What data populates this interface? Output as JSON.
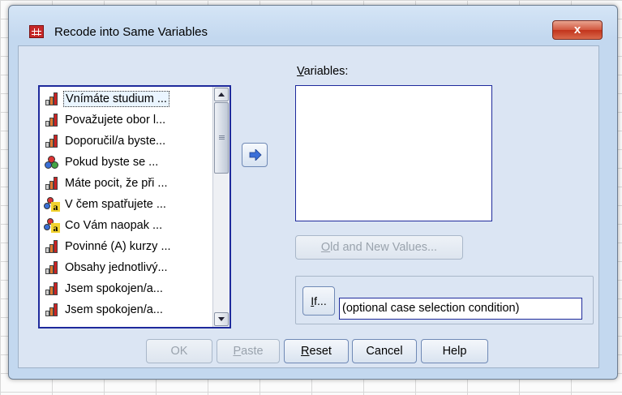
{
  "window": {
    "title": "Recode into Same Variables",
    "close_label": "x",
    "app_icon": "spss-data-grid-icon"
  },
  "source_list": {
    "items": [
      {
        "label": "Vnímáte studium ...",
        "icon": "ordinal-bar-icon",
        "selected": true
      },
      {
        "label": "Považujete obor l...",
        "icon": "ordinal-bar-icon"
      },
      {
        "label": "Doporučil/a byste...",
        "icon": "ordinal-bar-icon"
      },
      {
        "label": "Pokud byste se ...",
        "icon": "nominal-circles-icon"
      },
      {
        "label": "Máte pocit, že při ...",
        "icon": "ordinal-bar-icon"
      },
      {
        "label": "V čem spatřujete ...",
        "icon": "string-nominal-icon"
      },
      {
        "label": "Co Vám naopak ...",
        "icon": "string-nominal-icon"
      },
      {
        "label": "Povinné (A) kurzy ...",
        "icon": "ordinal-bar-icon"
      },
      {
        "label": "Obsahy jednotlivý...",
        "icon": "ordinal-bar-icon"
      },
      {
        "label": "Jsem spokojen/a...",
        "icon": "ordinal-bar-icon"
      },
      {
        "label": "Jsem spokojen/a...",
        "icon": "ordinal-bar-icon"
      }
    ]
  },
  "target": {
    "label_accel": "V",
    "label_rest": "ariables:"
  },
  "buttons": {
    "old_new_accel": "O",
    "old_new_rest": "ld and New Values...",
    "if_accel": "I",
    "if_rest": "f...",
    "if_condition": "(optional case selection condition)",
    "ok": "OK",
    "paste_accel": "P",
    "paste_rest": "aste",
    "reset_accel": "R",
    "reset_rest": "eset",
    "cancel": "Cancel",
    "help": "Help"
  },
  "colors": {
    "dialog_bg": "#dbe5f3",
    "list_border": "#1e2a9c",
    "close_red": "#c2331b",
    "arrow_blue": "#3b6fd8"
  }
}
